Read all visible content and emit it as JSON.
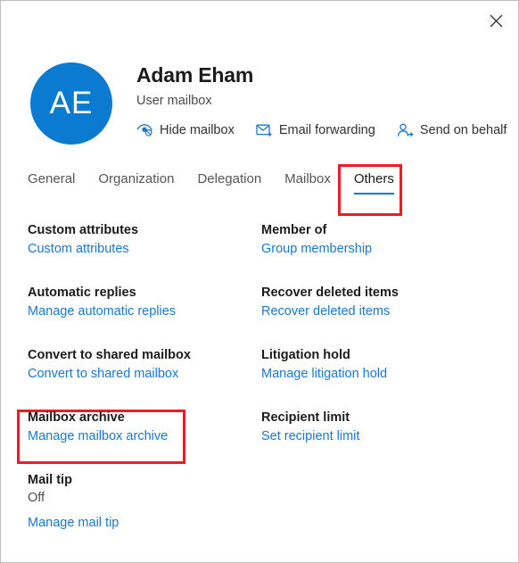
{
  "window": {
    "close_icon": "close-icon",
    "close_label": "Close"
  },
  "header": {
    "avatar_initials": "AE",
    "avatar_color": "#0b7ad1",
    "display_name": "Adam Eham",
    "subtitle": "User mailbox",
    "actions": [
      {
        "label": "Hide mailbox",
        "icon": "hide-mailbox-icon"
      },
      {
        "label": "Email forwarding",
        "icon": "email-forwarding-icon"
      },
      {
        "label": "Send on behalf",
        "icon": "send-on-behalf-icon"
      }
    ]
  },
  "tabs": {
    "items": [
      {
        "label": "General",
        "active": false
      },
      {
        "label": "Organization",
        "active": false
      },
      {
        "label": "Delegation",
        "active": false
      },
      {
        "label": "Mailbox",
        "active": false
      },
      {
        "label": "Others",
        "active": true
      }
    ],
    "active_index": 4,
    "active_underline_color": "#0b7ad1"
  },
  "highlights": {
    "color": "#ed1c24",
    "regions": [
      {
        "name": "others-tab-highlight"
      },
      {
        "name": "mailbox-archive-highlight"
      }
    ]
  },
  "content": {
    "left_column": [
      {
        "heading": "Custom attributes",
        "value": null,
        "link": "Custom attributes"
      },
      {
        "heading": "Automatic replies",
        "value": null,
        "link": "Manage automatic replies"
      },
      {
        "heading": "Convert to shared mailbox",
        "value": null,
        "link": "Convert to shared mailbox"
      },
      {
        "heading": "Mailbox archive",
        "value": null,
        "link": "Manage mailbox archive"
      },
      {
        "heading": "Mail tip",
        "value": "Off",
        "link": "Manage mail tip"
      }
    ],
    "right_column": [
      {
        "heading": "Member of",
        "value": null,
        "link": "Group membership"
      },
      {
        "heading": "Recover deleted items",
        "value": null,
        "link": "Recover deleted items"
      },
      {
        "heading": "Litigation hold",
        "value": null,
        "link": "Manage litigation hold"
      },
      {
        "heading": "Recipient limit",
        "value": null,
        "link": "Set recipient limit"
      }
    ]
  },
  "colors": {
    "link": "#1878cf",
    "heading": "#1b1b1b",
    "accent": "#0b7ad1",
    "highlight": "#ed1c24",
    "panel_border": "#bfbfbf"
  }
}
